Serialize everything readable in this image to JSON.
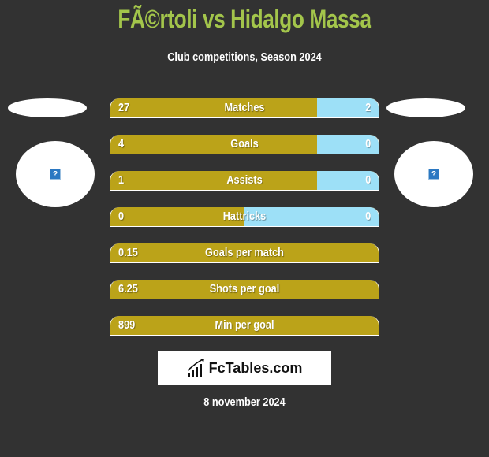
{
  "header": {
    "title": "FÃ©rtoli vs Hidalgo Massa",
    "subtitle": "Club competitions, Season 2024"
  },
  "players": {
    "left": {
      "image_icon": "broken-image-icon",
      "icon_glyph": "?"
    },
    "right": {
      "image_icon": "broken-image-icon",
      "icon_glyph": "?"
    }
  },
  "colors": {
    "title": "#a3c54b",
    "left_bar": "#bba319",
    "right_bar": "#9de0f7",
    "background": "#323232"
  },
  "stats": [
    {
      "label": "Matches",
      "left": "27",
      "right": "2",
      "left_share": 0.77
    },
    {
      "label": "Goals",
      "left": "4",
      "right": "0",
      "left_share": 0.77
    },
    {
      "label": "Assists",
      "left": "1",
      "right": "0",
      "left_share": 0.77
    },
    {
      "label": "Hattricks",
      "left": "0",
      "right": "0",
      "left_share": 0.5
    },
    {
      "label": "Goals per match",
      "left": "0.15",
      "right": "",
      "left_share": 1.0
    },
    {
      "label": "Shots per goal",
      "left": "6.25",
      "right": "",
      "left_share": 1.0
    },
    {
      "label": "Min per goal",
      "left": "899",
      "right": "",
      "left_share": 1.0
    }
  ],
  "logo": {
    "text": "FcTables.com",
    "icon": "bar-chart-icon"
  },
  "footer": {
    "date": "8 november 2024"
  }
}
